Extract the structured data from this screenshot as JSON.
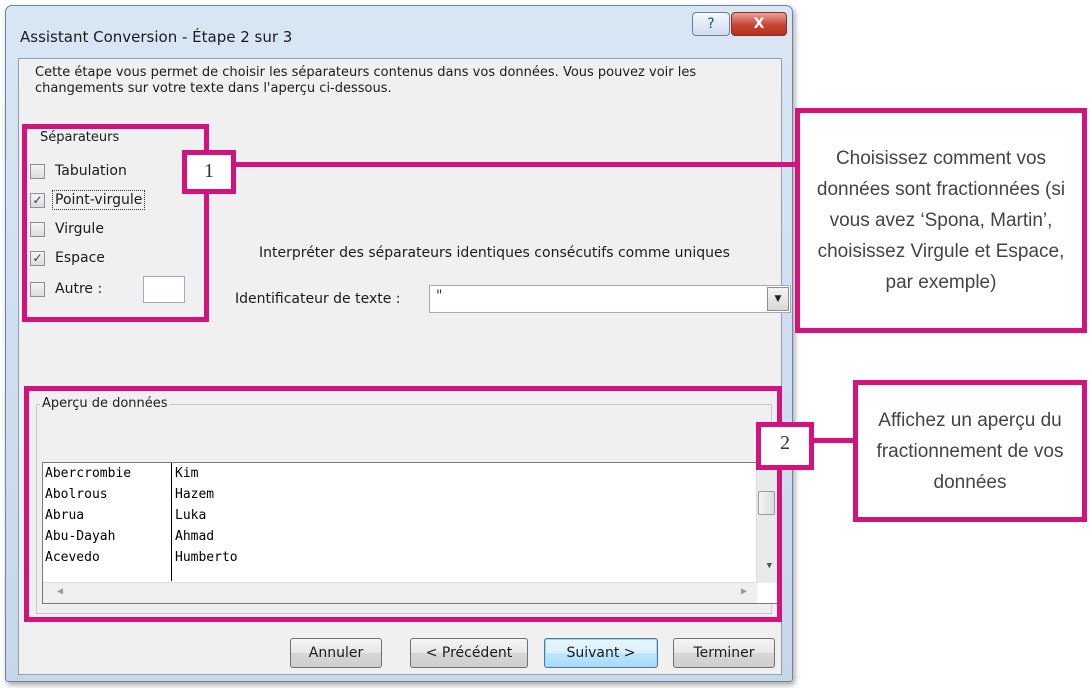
{
  "dialog": {
    "title": "Assistant Conversion - Étape 2 sur 3",
    "help_label": "?",
    "close_label": "X",
    "description": "Cette étape vous permet de choisir les séparateurs contenus dans vos données. Vous pouvez voir les changements sur votre texte dans l'aperçu ci-dessous."
  },
  "separators": {
    "group_label": "Séparateurs",
    "items": [
      {
        "label": "Tabulation",
        "checked": false
      },
      {
        "label": "Point-virgule",
        "checked": true
      },
      {
        "label": "Virgule",
        "checked": false
      },
      {
        "label": "Espace",
        "checked": true
      },
      {
        "label": "Autre :",
        "checked": false
      }
    ],
    "consecutive_label": "Interpréter des séparateurs identiques consécutifs comme uniques",
    "qualifier_label": "Identificateur de texte :",
    "qualifier_value": "\""
  },
  "preview": {
    "group_label": "Aperçu de données",
    "rows": [
      [
        "Abercrombie",
        "Kim"
      ],
      [
        "Abolrous",
        "Hazem"
      ],
      [
        "Abrua",
        "Luka"
      ],
      [
        "Abu-Dayah",
        "Ahmad"
      ],
      [
        "Acevedo",
        "Humberto"
      ]
    ]
  },
  "buttons": {
    "cancel": "Annuler",
    "previous": "< Précédent",
    "next": "Suivant >",
    "finish": "Terminer"
  },
  "callouts": {
    "one_number": "1",
    "one_text": "Choisissez comment vos données sont fractionnées (si vous avez ‘Spona, Martin’, choisissez Virgule et Espace, par exemple)",
    "two_number": "2",
    "two_text": "Affichez un aperçu du fractionnement de vos données"
  },
  "colors": {
    "callout_accent": "#d3127b"
  }
}
